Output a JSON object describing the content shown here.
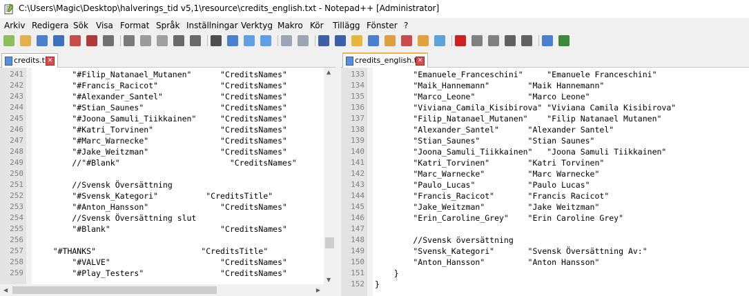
{
  "window": {
    "title": "C:\\Users\\Magic\\Desktop\\halverings_tid v5,1\\resource\\credits_english.txt - Notepad++ [Administrator]"
  },
  "menu": [
    "Arkiv",
    "Redigera",
    "Sök",
    "Visa",
    "Format",
    "Språk",
    "Inställningar",
    "Verktyg",
    "Makro",
    "Kör",
    "Tillägg",
    "Fönster",
    "?"
  ],
  "toolbar": {
    "icons": [
      "new-file-icon",
      "open-file-icon",
      "save-icon",
      "save-all-icon",
      "close-icon",
      "close-all-icon",
      "print-icon",
      "cut-icon",
      "copy-icon",
      "paste-icon",
      "undo-icon",
      "redo-icon",
      "find-icon",
      "replace-icon",
      "zoom-in-icon",
      "zoom-out-icon",
      "sync-vertical-icon",
      "sync-horizontal-icon",
      "word-wrap-icon",
      "show-all-chars-icon",
      "indent-guide-icon",
      "user-defined-lang-icon",
      "doc-map-icon",
      "function-list-icon",
      "folder-workspace-icon",
      "monitoring-icon",
      "record-macro-icon",
      "stop-macro-icon",
      "play-macro-icon",
      "run-macro-multiple-icon",
      "save-macro-icon",
      "show-preview-icon",
      "spell-check-icon"
    ]
  },
  "left_pane": {
    "tab_label": "credits.txt",
    "lines": [
      {
        "n": "241",
        "text": "        \"#Filip_Natanael_Mutanen\"      \"CreditsNames\""
      },
      {
        "n": "242",
        "text": "        \"#Francis_Racicot\"             \"CreditsNames\""
      },
      {
        "n": "243",
        "text": "        \"#Alexander_Santel\"            \"CreditsNames\""
      },
      {
        "n": "244",
        "text": "        \"#Stian_Saunes\"                \"CreditsNames\""
      },
      {
        "n": "245",
        "text": "        \"#Joona_Samuli_Tiikkainen\"     \"CreditsNames\""
      },
      {
        "n": "246",
        "text": "        \"#Katri_Torvinen\"              \"CreditsNames\""
      },
      {
        "n": "247",
        "text": "        \"#Marc_Warnecke\"               \"CreditsNames\""
      },
      {
        "n": "248",
        "text": "        \"#Jake_Weitzman\"               \"CreditsNames\""
      },
      {
        "n": "249",
        "text": "        //\"#Blank\"                       \"CreditsNames\""
      },
      {
        "n": "250",
        "text": ""
      },
      {
        "n": "251",
        "text": "        //Svensk Översättning"
      },
      {
        "n": "252",
        "text": "        \"#Svensk_Kategori\"          \"CreditsTitle\""
      },
      {
        "n": "253",
        "text": "        \"#Anton_Hansson\"               \"CreditsNames\""
      },
      {
        "n": "254",
        "text": "        //Svensk Översättning slut"
      },
      {
        "n": "255",
        "text": "        \"#Blank\"                       \"CreditsNames\""
      },
      {
        "n": "256",
        "text": ""
      },
      {
        "n": "257",
        "text": "    \"#THANKS\"                      \"CreditsTitle\""
      },
      {
        "n": "258",
        "text": "        \"#VALVE\"                       \"CreditsNames\""
      },
      {
        "n": "259",
        "text": "        \"#Play_Testers\"                \"CreditsNames\""
      }
    ]
  },
  "right_pane": {
    "tab_label": "credits_english.txt",
    "lines": [
      {
        "n": "133",
        "text": "        \"Emanuele_Franceschini\"     \"Emanuele Franceschini\""
      },
      {
        "n": "134",
        "text": "        \"Maik_Hannemann\"        \"Maik Hannemann\""
      },
      {
        "n": "135",
        "text": "        \"Marco_Leone\"           \"Marco Leone\""
      },
      {
        "n": "136",
        "text": "        \"Viviana_Camila_Kisibirova\" \"Viviana Camila Kisibirova\""
      },
      {
        "n": "137",
        "text": "        \"Filip_Natanael_Mutanen\"    \"Filip Natanael Mutanen\""
      },
      {
        "n": "138",
        "text": "        \"Alexander_Santel\"      \"Alexander Santel\""
      },
      {
        "n": "139",
        "text": "        \"Stian_Saunes\"          \"Stian Saunes\""
      },
      {
        "n": "140",
        "text": "        \"Joona_Samuli_Tiikkainen\"   \"Joona Samuli Tiikkainen\""
      },
      {
        "n": "141",
        "text": "        \"Katri_Torvinen\"        \"Katri Torvinen\""
      },
      {
        "n": "142",
        "text": "        \"Marc_Warnecke\"         \"Marc Warnecke\""
      },
      {
        "n": "143",
        "text": "        \"Paulo_Lucas\"           \"Paulo Lucas\""
      },
      {
        "n": "144",
        "text": "        \"Francis_Racicot\"       \"Francis Racicot\""
      },
      {
        "n": "145",
        "text": "        \"Jake_Weitzman\"         \"Jake Weitzman\""
      },
      {
        "n": "146",
        "text": "        \"Erin_Caroline_Grey\"    \"Erin Caroline Grey\""
      },
      {
        "n": "147",
        "text": ""
      },
      {
        "n": "148",
        "text": "        //Svensk översättning"
      },
      {
        "n": "149",
        "text": "        \"Svensk_Kategori\"       \"Svensk Översättning Av:\""
      },
      {
        "n": "150",
        "text": "        \"Anton_Hansson\"         \"Anton Hansson\""
      },
      {
        "n": "151",
        "text": "    }"
      },
      {
        "n": "152",
        "text": "}"
      }
    ]
  },
  "colors": {
    "active_tab_accent": "#fab040",
    "gutter": "#e4e4e4",
    "line_number": "#808080"
  }
}
